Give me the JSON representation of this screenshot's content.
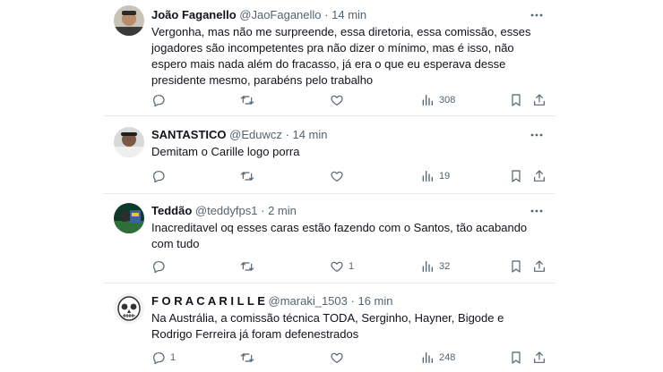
{
  "tweets": [
    {
      "name": "João Faganello",
      "handle": "@JaoFaganello",
      "time": "14 min",
      "text": "Vergonha, mas não me surpreende, essa diretoria, essa comissão, esses jogadores são incompetentes pra não dizer o mínimo, mas é isso, não espero mais nada além do fracasso, já era o que eu esperava desse presidente mesmo, parabéns pelo trabalho",
      "replies": "",
      "retweets": "",
      "likes": "",
      "views": "308"
    },
    {
      "name": "SANTASTICO",
      "handle": "@Eduwcz",
      "time": "14 min",
      "text": "Demitam o Carille logo porra",
      "replies": "",
      "retweets": "",
      "likes": "",
      "views": "19"
    },
    {
      "name": "Teddão",
      "handle": "@teddyfps1",
      "time": "2 min",
      "text": "Inacreditavel oq esses caras estão fazendo com o Santos, tão acabando com tudo",
      "replies": "",
      "retweets": "",
      "likes": "1",
      "views": "32"
    },
    {
      "name": "F O R A C A R I L L E",
      "handle": "@maraki_1503",
      "time": "16 min",
      "text": "Na Austrália, a comissão técnica TODA, Serginho, Hayner, Bigode e Rodrigo Ferreira já foram defenestrados",
      "replies": "1",
      "retweets": "",
      "likes": "",
      "views": "248"
    }
  ],
  "separator": "·",
  "icons": {
    "more": "more-horizontal-icon",
    "reply": "reply-icon",
    "retweet": "retweet-icon",
    "like": "heart-icon",
    "views": "views-bar-chart-icon",
    "bookmark": "bookmark-icon",
    "share": "share-icon"
  },
  "colors": {
    "text": "#0f1419",
    "secondary": "#536471",
    "divider": "#e6ecf0"
  }
}
